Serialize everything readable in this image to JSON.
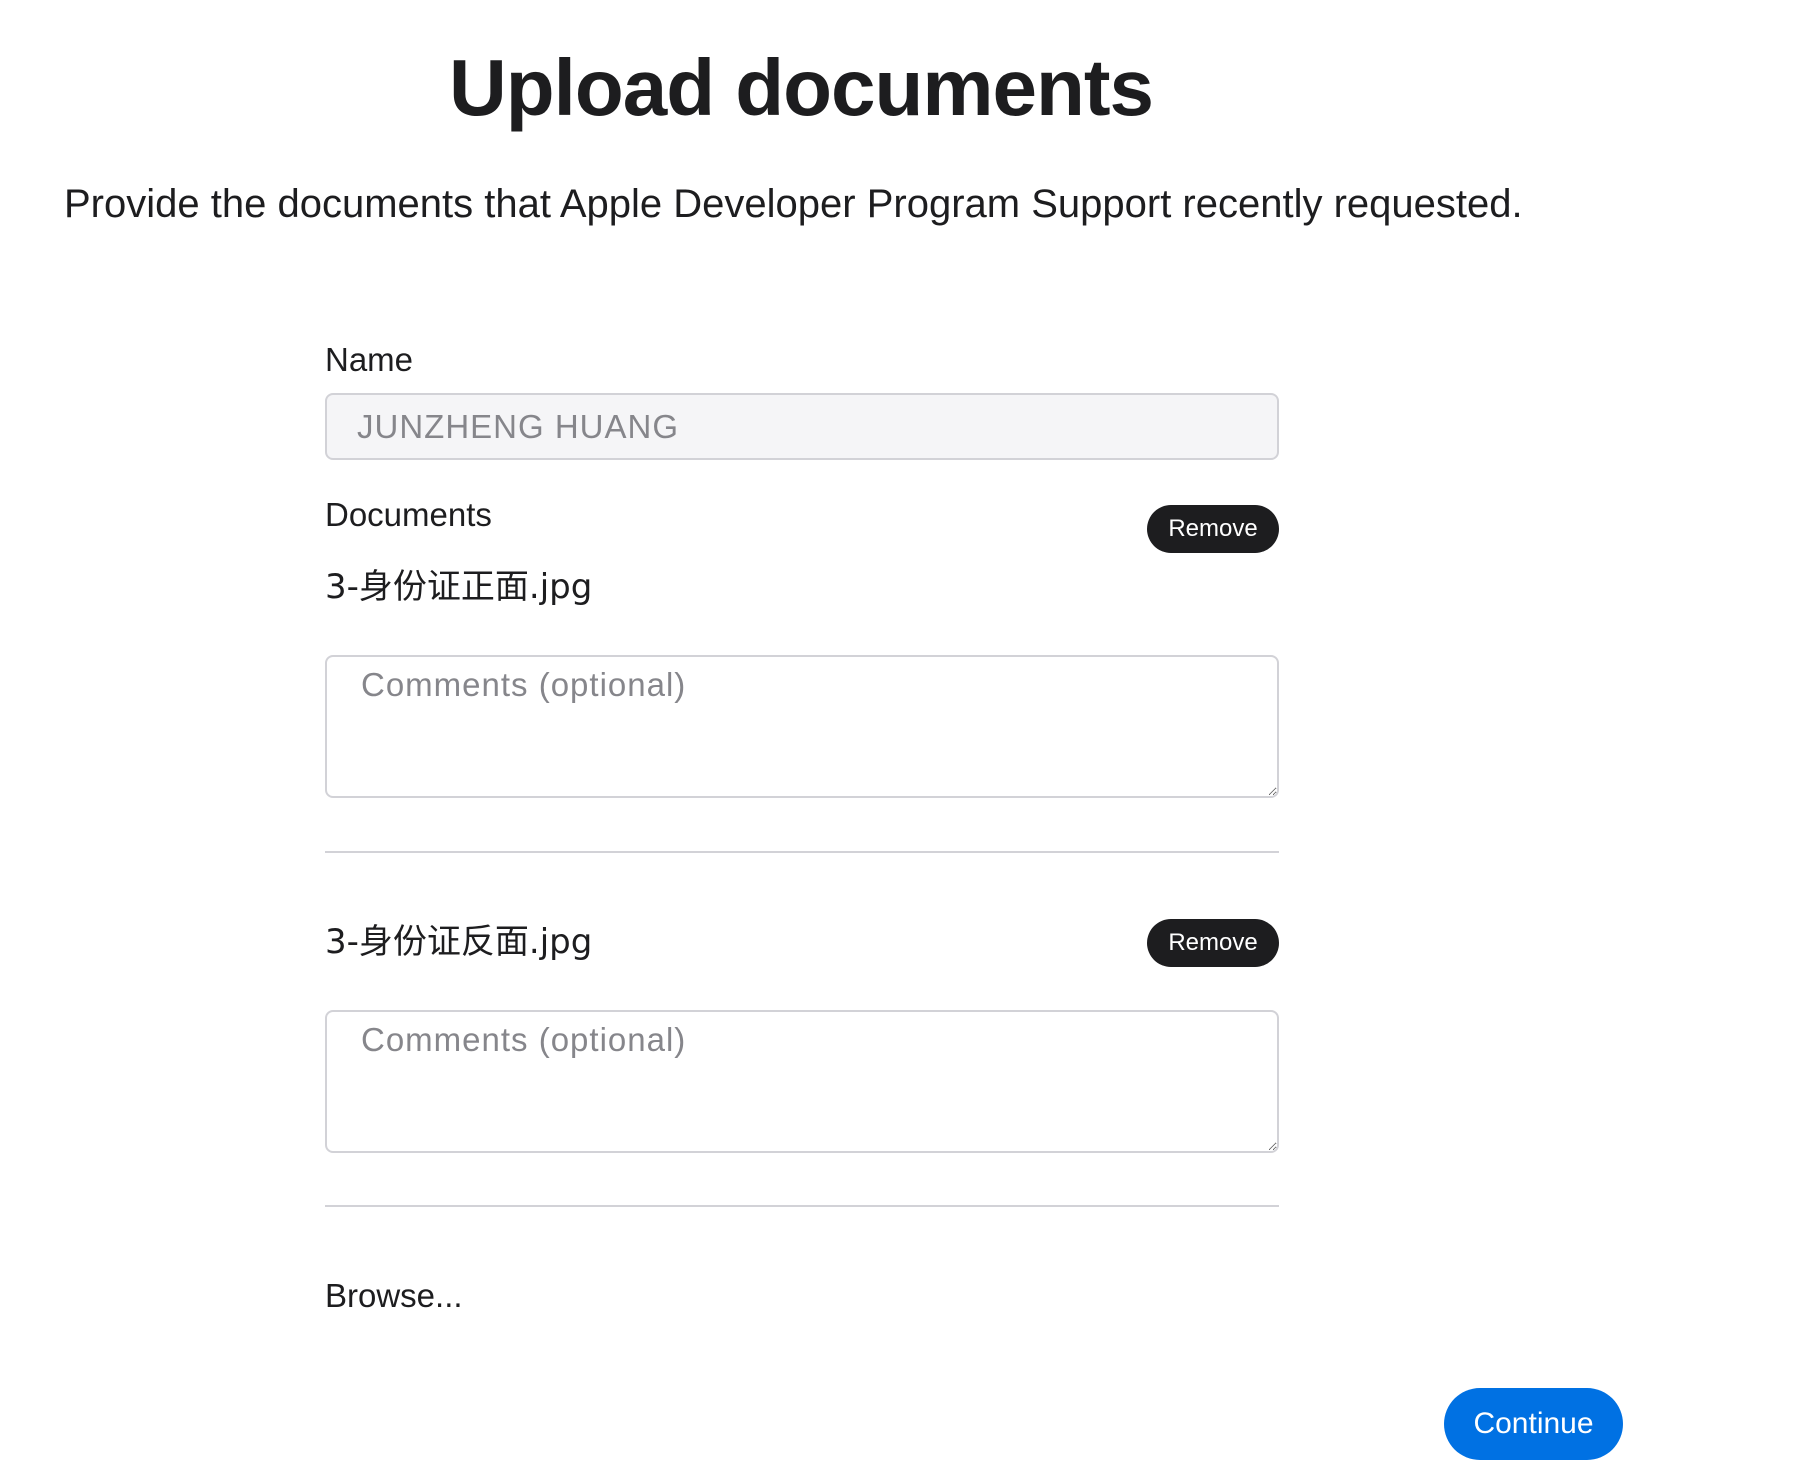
{
  "page": {
    "title": "Upload documents",
    "subtitle": "Provide the documents that Apple Developer Program Support recently requested."
  },
  "form": {
    "name_label": "Name",
    "name_value": "JUNZHENG HUANG",
    "documents_label": "Documents",
    "documents": [
      {
        "file_name": "3-身份证正面.jpg",
        "remove_label": "Remove",
        "comment_placeholder": "Comments (optional)"
      },
      {
        "file_name": "3-身份证反面.jpg",
        "remove_label": "Remove",
        "comment_placeholder": "Comments (optional)"
      }
    ],
    "browse_label": "Browse..."
  },
  "actions": {
    "continue_label": "Continue"
  },
  "colors": {
    "primary_button": "#0071e3",
    "remove_button": "#1d1d1f",
    "text": "#1d1d1f",
    "disabled_field_bg": "#f5f5f7",
    "border": "#d2d2d7"
  }
}
